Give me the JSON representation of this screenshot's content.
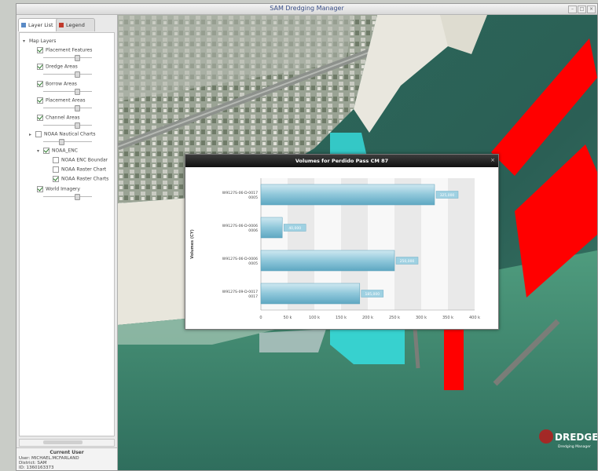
{
  "window": {
    "title": "SAM Dredging Manager"
  },
  "tabs": [
    {
      "label": "Layer List",
      "active": true
    },
    {
      "label": "Legend",
      "active": false
    }
  ],
  "tree": {
    "root": "Map Layers",
    "items": [
      {
        "label": "Placement Features",
        "checked": true,
        "level": 1
      },
      {
        "label": "Dredge Areas",
        "checked": true,
        "level": 1
      },
      {
        "label": "Borrow Areas",
        "checked": true,
        "level": 1
      },
      {
        "label": "Placement Areas",
        "checked": true,
        "level": 1
      },
      {
        "label": "Channel Areas",
        "checked": true,
        "level": 1
      },
      {
        "label": "NOAA Nautical Charts",
        "checked": false,
        "level": 1
      },
      {
        "label": "NOAA_ENC",
        "checked": true,
        "level": 2
      },
      {
        "label": "NOAA ENC Boundar",
        "checked": false,
        "level": 3
      },
      {
        "label": "NOAA Raster Chart",
        "checked": false,
        "level": 3
      },
      {
        "label": "NOAA Raster Charts",
        "checked": true,
        "level": 3
      },
      {
        "label": "World Imagery",
        "checked": true,
        "level": 1
      }
    ]
  },
  "user": {
    "header": "Current User",
    "user_line": "User: MICHAEL.MCFARLAND",
    "district_line": "District: SAM",
    "id_line": "ID: 1360163373"
  },
  "logo": {
    "text": "DREDGE",
    "subtext": "Dredging Manager"
  },
  "colors": {
    "channel_red": "#ff0000",
    "placement_cyan": "#36d9d9",
    "bar": "#8fc7da",
    "water": "#2f6e62"
  },
  "chart_data": {
    "type": "bar",
    "orientation": "horizontal",
    "title": "Volumes for Perdido Pass CM 87",
    "ylabel": "Volumes (CY)",
    "xlabel": "",
    "categories": [
      "W9127S-06-D-0017 0005",
      "W9127S-06-D-0006 0006",
      "W9127S-06-D-0006 0005",
      "W9127S-09-D-0017 0017"
    ],
    "values": [
      325000,
      40000,
      250000,
      185000
    ],
    "value_labels": [
      "325,000",
      "40,000",
      "250,000",
      "185,000"
    ],
    "xlim": [
      0,
      400000
    ],
    "xticks": [
      "0",
      "50 k",
      "100 k",
      "150 k",
      "200 k",
      "250 k",
      "300 k",
      "350 k",
      "400 k"
    ],
    "grid": true,
    "legend": "none"
  }
}
